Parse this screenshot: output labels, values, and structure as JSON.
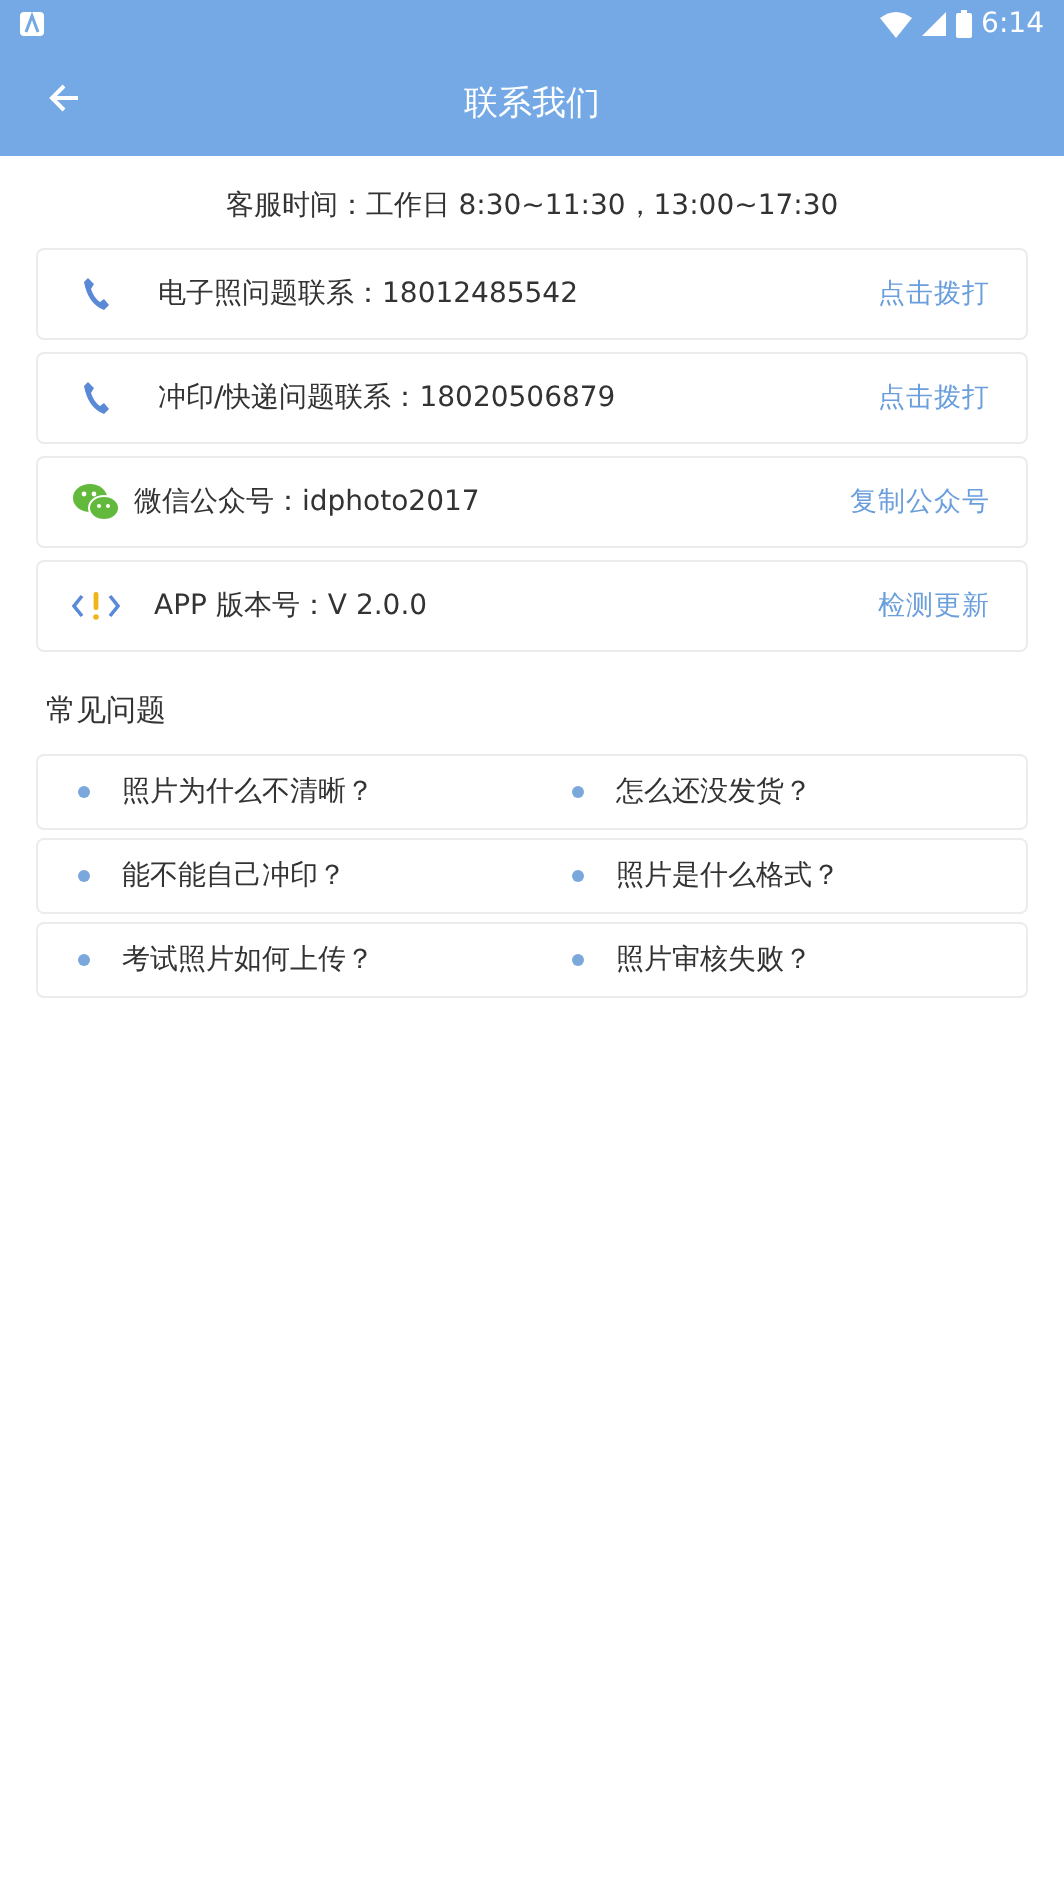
{
  "status_bar": {
    "time": "6:14"
  },
  "app_bar": {
    "title": "联系我们"
  },
  "service_hours": "客服时间：工作日  8:30~11:30，13:00~17:30",
  "contacts": [
    {
      "kind": "phone",
      "label": "电子照问题联系：18012485542",
      "action": "点击拨打"
    },
    {
      "kind": "phone",
      "label": "冲印/快递问题联系：18020506879",
      "action": "点击拨打"
    },
    {
      "kind": "wechat",
      "label": "微信公众号：idphoto2017",
      "action": "复制公众号"
    },
    {
      "kind": "version",
      "label": "APP 版本号：V 2.0.0",
      "action": "检测更新"
    }
  ],
  "faq": {
    "title": "常见问题",
    "rows": [
      [
        "照片为什么不清晰？",
        "怎么还没发货？"
      ],
      [
        "能不能自己冲印？",
        "照片是什么格式？"
      ],
      [
        "考试照片如何上传？",
        "照片审核失败？"
      ]
    ]
  }
}
